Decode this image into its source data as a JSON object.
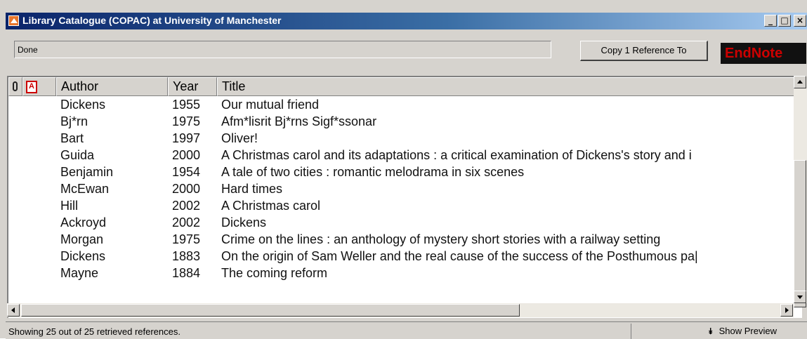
{
  "window": {
    "title": "Library Catalogue (COPAC) at University of Manchester",
    "minimize_glyph": "_",
    "maximize_glyph": "□",
    "close_glyph": "×"
  },
  "toolbar": {
    "status_text": "Done",
    "copy_button_label": "Copy 1 Reference To",
    "endnote_logo": "EndNote"
  },
  "columns": [
    {
      "label": "",
      "icon": "paperclip-icon"
    },
    {
      "label": "",
      "icon": "pdf-icon"
    },
    {
      "label": "Author"
    },
    {
      "label": "Year"
    },
    {
      "label": "Title"
    }
  ],
  "rows": [
    {
      "author": "Dickens",
      "year": "1955",
      "title": "Our mutual friend"
    },
    {
      "author": "Bj*rn",
      "year": "1975",
      "title": "Afm*lisrit Bj*rns Sigf*ssonar"
    },
    {
      "author": "Bart",
      "year": "1997",
      "title": "Oliver!"
    },
    {
      "author": "Guida",
      "year": "2000",
      "title": "A Christmas carol and its adaptations : a critical examination of Dickens's story and i"
    },
    {
      "author": "Benjamin",
      "year": "1954",
      "title": "A tale of two cities : romantic melodrama in six scenes"
    },
    {
      "author": "McEwan",
      "year": "2000",
      "title": "Hard times"
    },
    {
      "author": "Hill",
      "year": "2002",
      "title": "A Christmas carol"
    },
    {
      "author": "Ackroyd",
      "year": "2002",
      "title": "Dickens"
    },
    {
      "author": "Morgan",
      "year": "1975",
      "title": "Crime on the lines : an anthology of mystery short stories with a railway setting"
    },
    {
      "author": "Dickens",
      "year": "1883",
      "title": "On the origin of Sam Weller and the real cause of the success of the Posthumous pa|"
    },
    {
      "author": "Mayne",
      "year": "1884",
      "title": "The coming reform"
    }
  ],
  "statusbar": {
    "message": "Showing 25 out of 25 retrieved references.",
    "preview_label": "Show Preview",
    "preview_icon": "double-chevron-down-icon"
  },
  "colors": {
    "titlebar_start": "#0a246a",
    "titlebar_end": "#a6caf0",
    "chrome": "#d6d3ce",
    "endnote_red": "#cc0000"
  }
}
